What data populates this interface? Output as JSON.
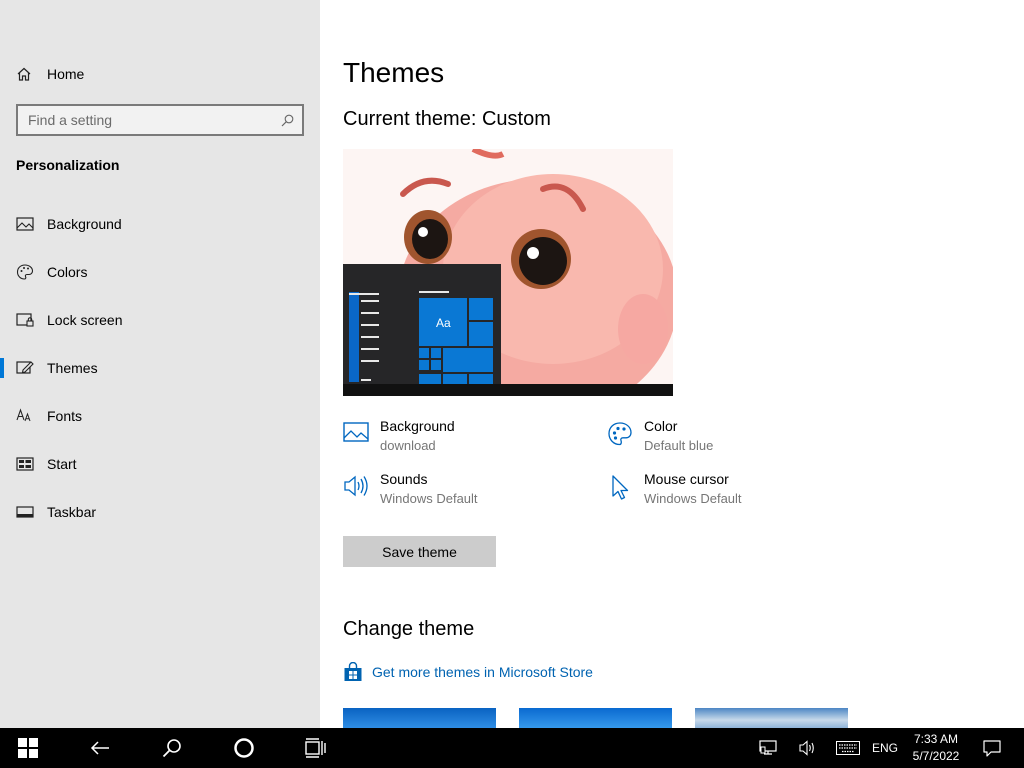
{
  "sidebar": {
    "home_label": "Home",
    "search_placeholder": "Find a setting",
    "section_title": "Personalization",
    "items": [
      {
        "label": "Background",
        "icon": "image-icon"
      },
      {
        "label": "Colors",
        "icon": "palette-icon"
      },
      {
        "label": "Lock screen",
        "icon": "lock-screen-icon"
      },
      {
        "label": "Themes",
        "icon": "themes-icon",
        "selected": true
      },
      {
        "label": "Fonts",
        "icon": "fonts-icon"
      },
      {
        "label": "Start",
        "icon": "start-icon"
      },
      {
        "label": "Taskbar",
        "icon": "taskbar-icon"
      }
    ]
  },
  "main": {
    "title": "Themes",
    "current_theme": "Current theme: Custom",
    "preview_tile_label": "Aa",
    "properties": {
      "background": {
        "name": "Background",
        "value": "download"
      },
      "color": {
        "name": "Color",
        "value": "Default blue"
      },
      "sounds": {
        "name": "Sounds",
        "value": "Windows Default"
      },
      "mouse_cursor": {
        "name": "Mouse cursor",
        "value": "Windows Default"
      }
    },
    "save_button": "Save theme",
    "change_theme_title": "Change theme",
    "store_link": "Get more themes in Microsoft Store"
  },
  "taskbar": {
    "language": "ENG",
    "time": "7:33 AM",
    "date": "5/7/2022"
  },
  "colors": {
    "accent": "#0078d7",
    "link": "#0063b1",
    "sidebar_bg": "#e6e6e6",
    "taskbar_bg": "#000000"
  }
}
